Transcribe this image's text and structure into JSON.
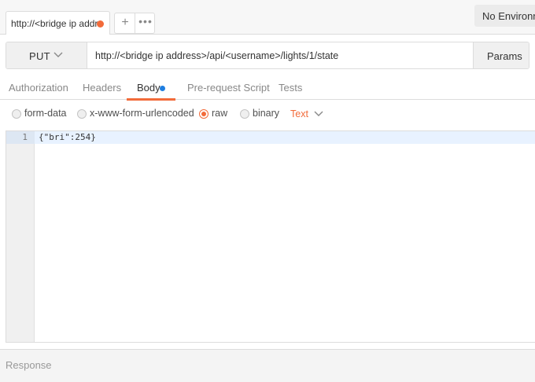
{
  "tab": {
    "label": "http://<bridge ip addr"
  },
  "tab_controls": {
    "new_tab": "+",
    "more": "•••"
  },
  "environment": {
    "selected": "No Environment"
  },
  "request": {
    "method": "PUT",
    "url": "http://<bridge ip address>/api/<username>/lights/1/state",
    "params_label": "Params"
  },
  "request_tabs": [
    {
      "label": "Authorization",
      "active": false
    },
    {
      "label": "Headers",
      "active": false
    },
    {
      "label": "Body",
      "active": true
    },
    {
      "label": "Pre-request Script",
      "active": false
    },
    {
      "label": "Tests",
      "active": false
    }
  ],
  "body_types": [
    {
      "label": "form-data",
      "checked": false
    },
    {
      "label": "x-www-form-urlencoded",
      "checked": false
    },
    {
      "label": "raw",
      "checked": true
    },
    {
      "label": "binary",
      "checked": false
    }
  ],
  "raw_format": "Text",
  "editor": {
    "lines": [
      {
        "number": "1",
        "text": "{\"bri\":254}"
      }
    ]
  },
  "response": {
    "label": "Response"
  },
  "colors": {
    "accent": "#f26b3a",
    "indicator": "#1f7ee0"
  }
}
